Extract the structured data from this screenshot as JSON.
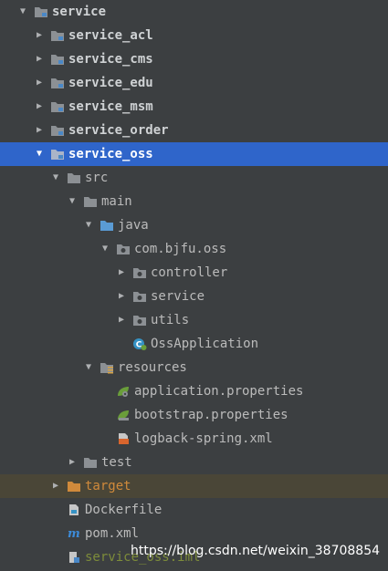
{
  "tree": {
    "root": "service",
    "modules": [
      "service_acl",
      "service_cms",
      "service_edu",
      "service_msm",
      "service_order"
    ],
    "selected_module": "service_oss",
    "src": "src",
    "main": "main",
    "java": "java",
    "package": "com.bjfu.oss",
    "controller": "controller",
    "service_pkg": "service",
    "utils": "utils",
    "app_class": "OssApplication",
    "resources": "resources",
    "app_props": "application.properties",
    "bootstrap_props": "bootstrap.properties",
    "logback": "logback-spring.xml",
    "test": "test",
    "target": "target",
    "dockerfile": "Dockerfile",
    "pom": "pom.xml",
    "iml": "service_oss.iml"
  },
  "watermark": "https://blog.csdn.net/weixin_38708854",
  "colors": {
    "background": "#3c3f41",
    "selected": "#2f65ca",
    "folder": "#8c9094",
    "source_folder": "#5a9bd4",
    "excluded_label": "#d08a3b",
    "iml_label": "#7d8c3a"
  }
}
